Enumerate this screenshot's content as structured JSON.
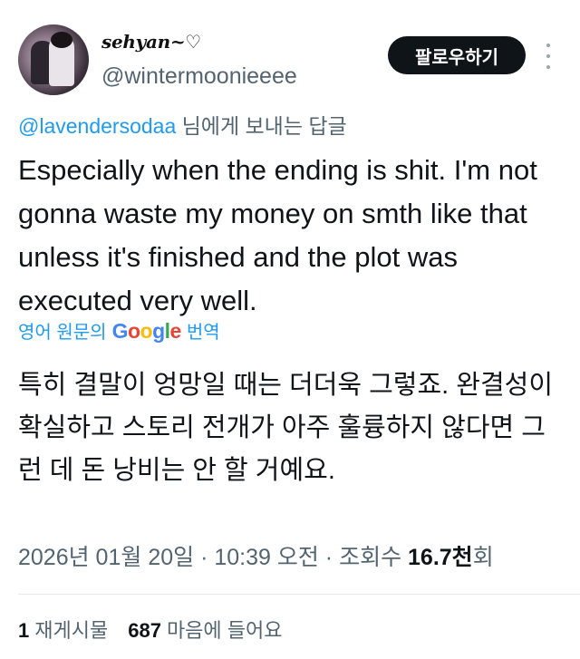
{
  "profile": {
    "display_name": "sehyan~♡",
    "handle": "@wintermoonieeee",
    "avatar": "avatar-photo"
  },
  "header": {
    "follow_label": "팔로우하기",
    "more_icon": "more-vertical-icon"
  },
  "reply": {
    "mention": "@lavendersodaa",
    "suffix": " 님에게 보내는 답글"
  },
  "tweet": {
    "text": "Especially when the ending is shit. I'm not gonna waste my money on smth like that unless it's finished and the plot was executed very well."
  },
  "translation": {
    "prefix": "영어 원문의",
    "google_letters": [
      "G",
      "o",
      "o",
      "g",
      "l",
      "e"
    ],
    "suffix": "번역",
    "text": "특히 결말이 엉망일 때는 더더욱 그렇죠. 완결성이 확실하고 스토리 전개가 아주 훌륭하지 않다면 그런 데 돈 낭비는 안 할 거예요."
  },
  "meta": {
    "datetime": "2026년 01월 20일 · 10:39 오전 · 조회수 ",
    "views": "16.7천",
    "views_suffix": "회"
  },
  "stats": {
    "reposts_count": "1",
    "reposts_label": "재게시물",
    "likes_count": "687",
    "likes_label": "마음에 들어요"
  },
  "colors": {
    "link": "#1d9bf0",
    "secondary_text": "#536471",
    "primary_text": "#0f1419",
    "button_bg": "#0f1419"
  }
}
